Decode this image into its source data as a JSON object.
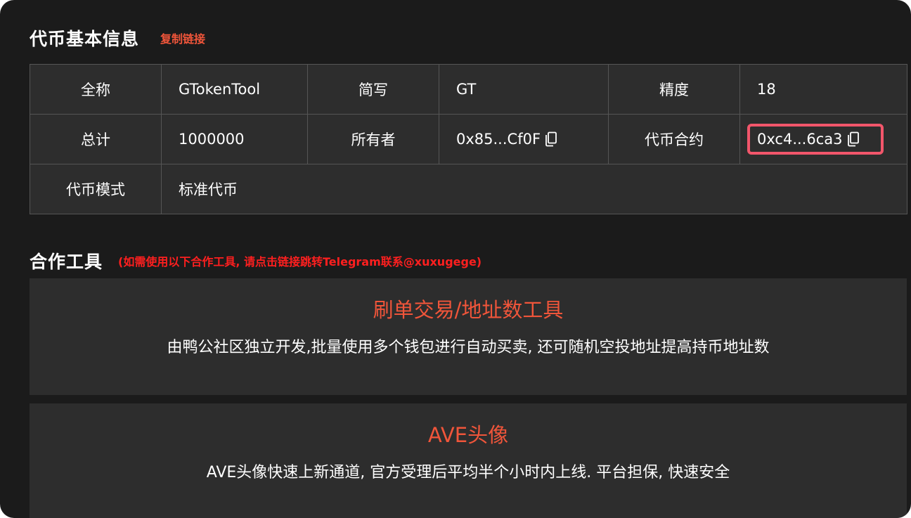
{
  "basic_info": {
    "title": "代币基本信息",
    "copy_link": "复制链接",
    "rows": [
      [
        {
          "label": "全称",
          "value": "GTokenTool"
        },
        {
          "label": "简写",
          "value": "GT"
        },
        {
          "label": "精度",
          "value": "18"
        }
      ],
      [
        {
          "label": "总计",
          "value": "1000000"
        },
        {
          "label": "所有者",
          "value": "0x85...Cf0F"
        },
        {
          "label": "代币合约",
          "value": "0xc4...6ca3"
        }
      ],
      [
        {
          "label": "代币模式",
          "value": "标准代币"
        }
      ]
    ]
  },
  "cooperation": {
    "title": "合作工具",
    "note": "(如需使用以下合作工具, 请点击链接跳转Telegram联系@xuxugege)",
    "tools": [
      {
        "title": "刷单交易/地址数工具",
        "desc": "由鸭公社区独立开发,批量使用多个钱包进行自动买卖, 还可随机空投地址提高持币地址数"
      },
      {
        "title": "AVE头像",
        "desc": "AVE头像快速上新通道, 官方受理后平均半个小时内上线. 平台担保, 快速安全"
      }
    ]
  },
  "icons": {
    "copy": "copy-icon"
  },
  "colors": {
    "background": "#1b1b1b",
    "panel": "#2d2d2d",
    "accent": "#f0553a",
    "note_red": "#ff1f1f",
    "highlight_border": "#f2566b"
  }
}
